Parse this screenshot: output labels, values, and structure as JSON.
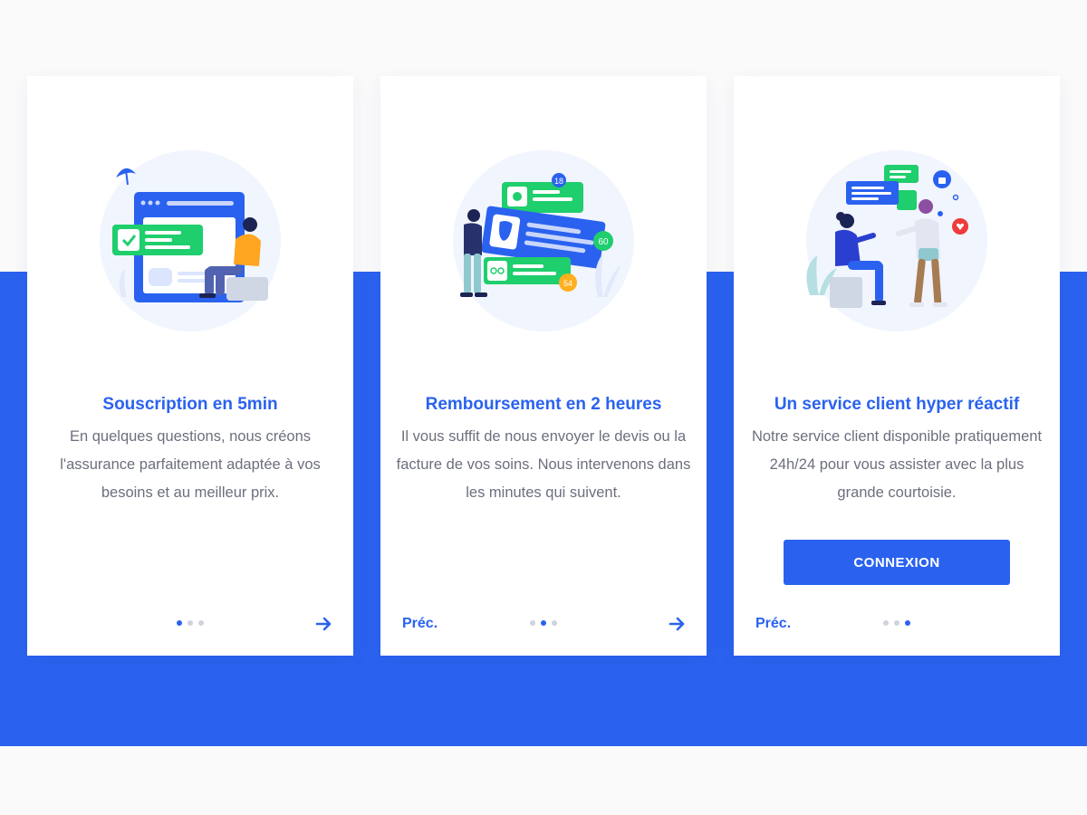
{
  "colors": {
    "accent": "#2a62ef",
    "green": "#1fce6d",
    "text": "#6c6f7d",
    "dot_inactive": "#cfd3dc"
  },
  "cards": [
    {
      "title": "Souscription en 5min",
      "description": "En quelques questions, nous créons l'assurance parfaitement adaptée à vos besoins et au meilleur prix.",
      "illustration": "form-signup-illustration",
      "prev_label": "",
      "pagination": {
        "current": 1,
        "total": 3
      },
      "next_icon": "arrow-right-icon"
    },
    {
      "title": "Remboursement en 2 heures",
      "description": "Il vous suffit de nous envoyer le devis ou la facture de vos soins. Nous intervenons dans les minutes qui suivent.",
      "illustration": "refund-cards-illustration",
      "badges": [
        "18",
        "60",
        "54"
      ],
      "prev_label": "Préc.",
      "pagination": {
        "current": 2,
        "total": 3
      },
      "next_icon": "arrow-right-icon"
    },
    {
      "title": "Un service client hyper réactif",
      "description": "Notre service client disponible pratiquement 24h/24 pour vous assister avec la plus grande courtoisie.",
      "illustration": "customer-service-illustration",
      "button_label": "CONNEXION",
      "prev_label": "Préc.",
      "pagination": {
        "current": 3,
        "total": 3
      }
    }
  ]
}
